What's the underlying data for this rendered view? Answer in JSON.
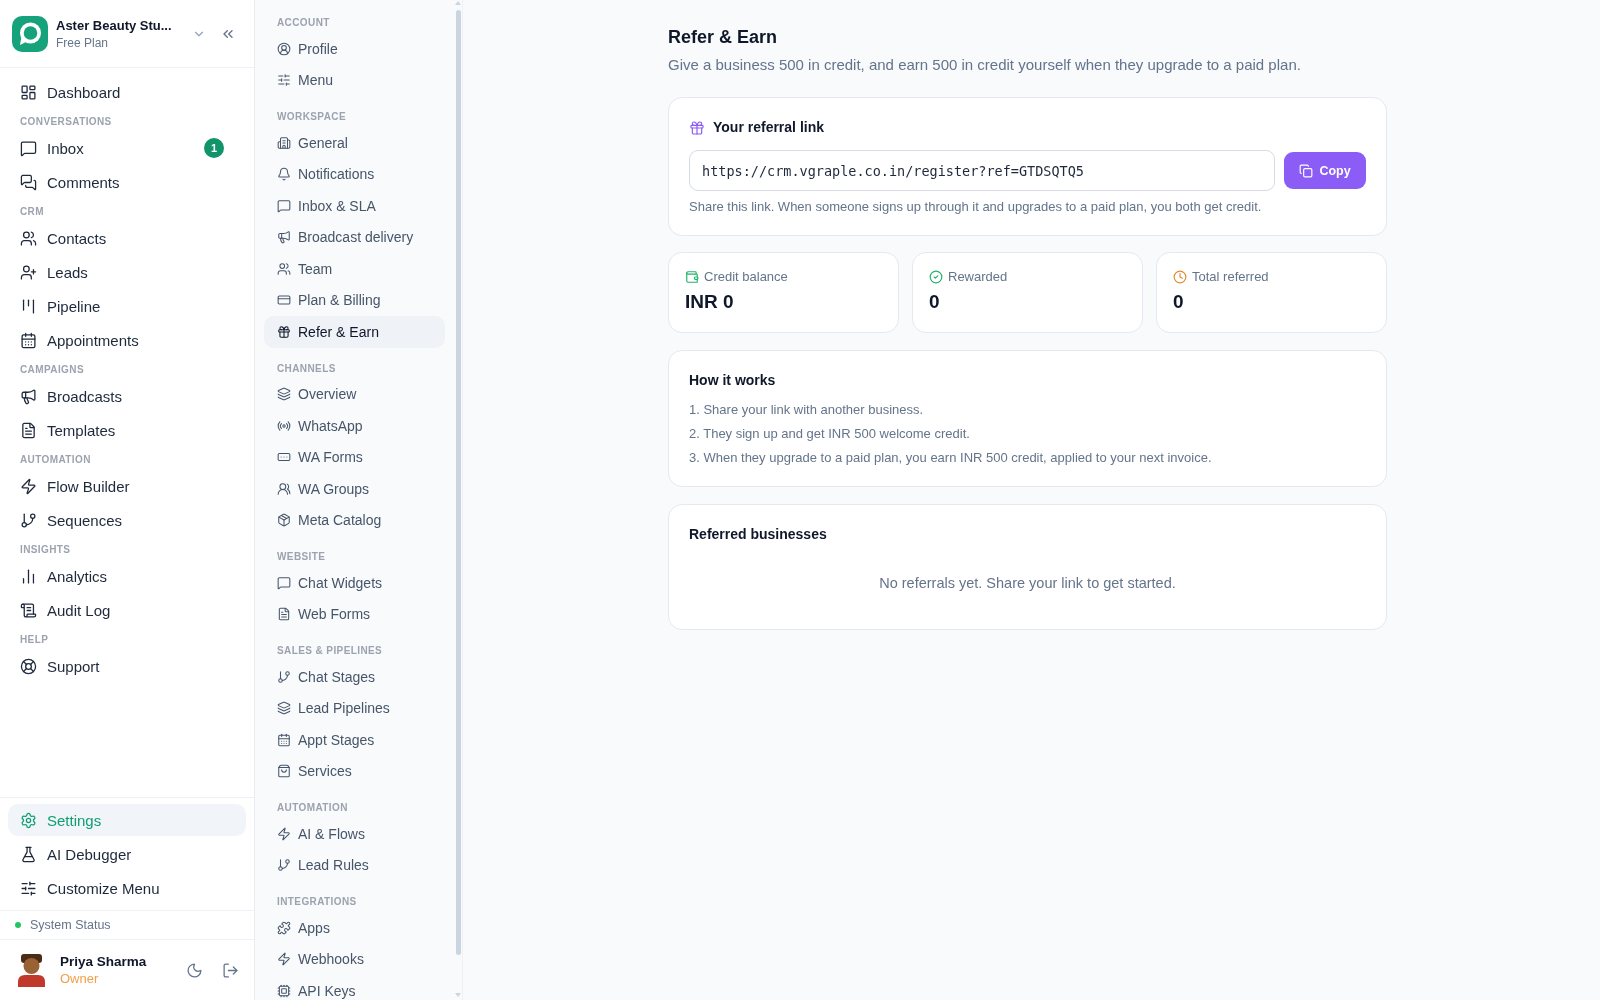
{
  "sidebar": {
    "workspace": {
      "name": "Aster Beauty Stu...",
      "plan": "Free Plan"
    },
    "nav": [
      {
        "items": [
          {
            "label": "Dashboard",
            "selected": false
          }
        ]
      },
      {
        "heading": "CONVERSATIONS",
        "items": [
          {
            "label": "Inbox",
            "badge": "1",
            "selected": false
          },
          {
            "label": "Comments",
            "selected": false
          }
        ]
      },
      {
        "heading": "CRM",
        "items": [
          {
            "label": "Contacts",
            "selected": false
          },
          {
            "label": "Leads",
            "selected": false
          },
          {
            "label": "Pipeline",
            "selected": false
          },
          {
            "label": "Appointments",
            "selected": false
          }
        ]
      },
      {
        "heading": "CAMPAIGNS",
        "items": [
          {
            "label": "Broadcasts",
            "selected": false
          },
          {
            "label": "Templates",
            "selected": false
          }
        ]
      },
      {
        "heading": "AUTOMATION",
        "items": [
          {
            "label": "Flow Builder",
            "selected": false
          },
          {
            "label": "Sequences",
            "selected": false
          }
        ]
      },
      {
        "heading": "INSIGHTS",
        "items": [
          {
            "label": "Analytics",
            "selected": false
          },
          {
            "label": "Audit Log",
            "selected": false
          }
        ]
      },
      {
        "heading": "HELP",
        "items": [
          {
            "label": "Support",
            "selected": false
          }
        ]
      }
    ],
    "footer_nav": [
      {
        "label": "Settings",
        "selected": true
      },
      {
        "label": "AI Debugger",
        "selected": false
      },
      {
        "label": "Customize Menu",
        "selected": false
      }
    ],
    "system_status": {
      "label": "System Status",
      "operational": true
    },
    "user": {
      "name": "Priya Sharma",
      "role": "Owner"
    }
  },
  "settings_nav": {
    "sections": [
      {
        "heading": "ACCOUNT",
        "items": [
          {
            "label": "Profile",
            "selected": false
          },
          {
            "label": "Menu",
            "selected": false
          }
        ]
      },
      {
        "heading": "WORKSPACE",
        "items": [
          {
            "label": "General",
            "selected": false
          },
          {
            "label": "Notifications",
            "selected": false
          },
          {
            "label": "Inbox & SLA",
            "selected": false
          },
          {
            "label": "Broadcast delivery",
            "selected": false
          },
          {
            "label": "Team",
            "selected": false
          },
          {
            "label": "Plan & Billing",
            "selected": false
          },
          {
            "label": "Refer & Earn",
            "selected": true
          }
        ]
      },
      {
        "heading": "CHANNELS",
        "items": [
          {
            "label": "Overview",
            "selected": false
          },
          {
            "label": "WhatsApp",
            "selected": false
          },
          {
            "label": "WA Forms",
            "selected": false
          },
          {
            "label": "WA Groups",
            "selected": false
          },
          {
            "label": "Meta Catalog",
            "selected": false
          }
        ]
      },
      {
        "heading": "WEBSITE",
        "items": [
          {
            "label": "Chat Widgets",
            "selected": false
          },
          {
            "label": "Web Forms",
            "selected": false
          }
        ]
      },
      {
        "heading": "SALES & PIPELINES",
        "items": [
          {
            "label": "Chat Stages",
            "selected": false
          },
          {
            "label": "Lead Pipelines",
            "selected": false
          },
          {
            "label": "Appt Stages",
            "selected": false
          },
          {
            "label": "Services",
            "selected": false
          }
        ]
      },
      {
        "heading": "AUTOMATION",
        "items": [
          {
            "label": "AI & Flows",
            "selected": false
          },
          {
            "label": "Lead Rules",
            "selected": false
          }
        ]
      },
      {
        "heading": "INTEGRATIONS",
        "items": [
          {
            "label": "Apps",
            "selected": false
          },
          {
            "label": "Webhooks",
            "selected": false
          },
          {
            "label": "API Keys",
            "selected": false
          }
        ]
      }
    ]
  },
  "page": {
    "title": "Refer & Earn",
    "subtitle": "Give a business 500 in credit, and earn 500 in credit yourself when they upgrade to a paid plan."
  },
  "referral": {
    "title": "Your referral link",
    "link": "https://crm.vgraple.co.in/register?ref=GTDSQTQ5",
    "copy_button": "Copy",
    "hint": "Share this link. When someone signs up through it and upgrades to a paid plan, you both get credit."
  },
  "stats": [
    {
      "label": "Credit balance",
      "value": "INR 0"
    },
    {
      "label": "Rewarded",
      "value": "0"
    },
    {
      "label": "Total referred",
      "value": "0"
    }
  ],
  "how_it_works": {
    "title": "How it works",
    "steps": [
      "1. Share your link with another business.",
      "2. They sign up and get INR 500 welcome credit.",
      "3. When they upgrade to a paid plan, you earn INR 500 credit, applied to your next invoice."
    ]
  },
  "referred_businesses": {
    "title": "Referred businesses",
    "empty_message": "No referrals yet. Share your link to get started."
  }
}
